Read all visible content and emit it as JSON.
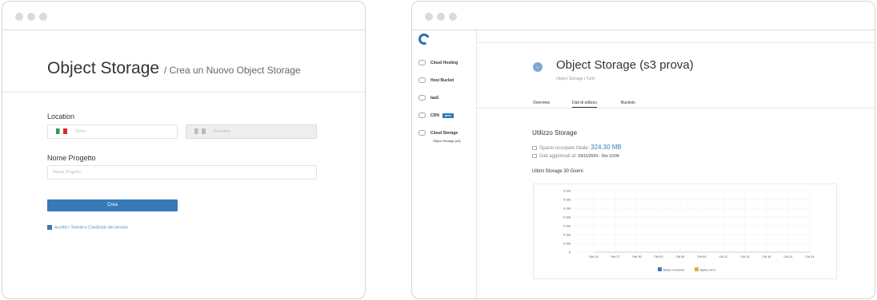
{
  "left": {
    "title": "Object Storage",
    "subtitle": "/ Crea un Nuovo Object Storage",
    "location_label": "Location",
    "location_value": "Torino",
    "location_disabled": "Prossimo",
    "project_label": "Nome Progetto",
    "project_placeholder": "Nuovo Progetto",
    "create_button": "Crea",
    "terms_text": "Accetto i Termini e Condizioni del servizio"
  },
  "right": {
    "sidebar": {
      "items": [
        {
          "label": "Cloud Hosting",
          "icon": "cloud-icon"
        },
        {
          "label": "Host Bucket",
          "icon": "server-icon"
        },
        {
          "label": "IaaS",
          "icon": "iaas-icon"
        },
        {
          "label": "CDN",
          "icon": "cdn-icon",
          "badge": "BETA"
        },
        {
          "label": "Cloud Storage",
          "icon": "cloud-storage-icon"
        }
      ],
      "sub_item": "Object Storage (s3)"
    },
    "title": "Object Storage (s3 prova)",
    "breadcrumb": "Object Storage | Turin",
    "tabs": [
      "Overview",
      "Dati di utilizzo",
      "Buckets"
    ],
    "active_tab": 1,
    "usage_title": "Utilizzo Storage",
    "space_label": "Spazio occupato totale:",
    "space_value": "324.30 MB",
    "updated_label": "Dati aggiornati al:",
    "updated_value": "03/11/2024 - Ore 10:04",
    "chart_title": "Ultimi Storage 30 Giorni"
  },
  "chart_data": {
    "type": "line",
    "title": "Ultimi Storage 30 Giorni",
    "x": [
      "Set 24",
      "Set 27",
      "Set 30",
      "Ott 03",
      "Ott 06",
      "Ott 09",
      "Ott 12",
      "Ott 15",
      "Ott 18",
      "Ott 21",
      "Ott 24"
    ],
    "y_ticks": [
      "0 GB",
      "0 GB",
      "0 GB",
      "0 GB",
      "0 GB",
      "0 GB",
      "0 GB",
      "0"
    ],
    "series": [
      {
        "name": "Bytes received",
        "color": "#3879b8",
        "values": [
          0,
          0,
          0,
          0,
          0,
          0,
          0,
          0,
          0,
          0,
          0
        ]
      },
      {
        "name": "Bytes sent",
        "color": "#e0b03a",
        "values": [
          0,
          0,
          0,
          0,
          0,
          0,
          0,
          0,
          0,
          0,
          0
        ]
      }
    ],
    "legend": "bottom-center",
    "grid": true
  }
}
